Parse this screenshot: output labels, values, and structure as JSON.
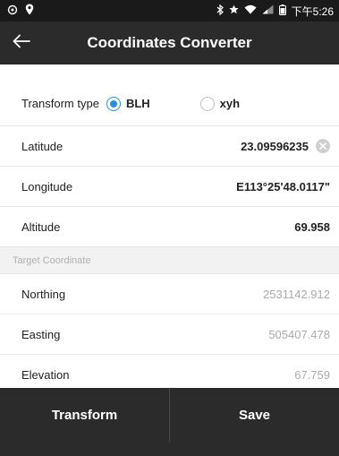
{
  "status_bar": {
    "time": "下午5:26"
  },
  "app_bar": {
    "title": "Coordinates Converter"
  },
  "transform": {
    "label": "Transform type",
    "options": [
      {
        "label": "BLH",
        "selected": true
      },
      {
        "label": "xyh",
        "selected": false
      }
    ]
  },
  "source": {
    "latitude": {
      "label": "Latitude",
      "value": "23.09596235"
    },
    "longitude": {
      "label": "Longitude",
      "value": "E113°25'48.0117\""
    },
    "altitude": {
      "label": "Altitude",
      "value": "69.958"
    }
  },
  "target": {
    "header": "Target Coordinate",
    "northing": {
      "label": "Northing",
      "value": "2531142.912"
    },
    "easting": {
      "label": "Easting",
      "value": "505407.478"
    },
    "elevation": {
      "label": "Elevation",
      "value": "67.759"
    }
  },
  "actions": {
    "transform_label": "Transform",
    "save_label": "Save"
  },
  "colors": {
    "accent": "#2a8de0",
    "app_bar": "#2b2b2b",
    "status_bar": "#1a1a1a",
    "muted_text": "#aaaaaa"
  },
  "icons": [
    "camera-icon",
    "location-pin-icon",
    "bluetooth-icon",
    "star-icon",
    "wifi-icon",
    "signal-icon",
    "battery-icon",
    "back-arrow-icon",
    "clear-icon"
  ]
}
